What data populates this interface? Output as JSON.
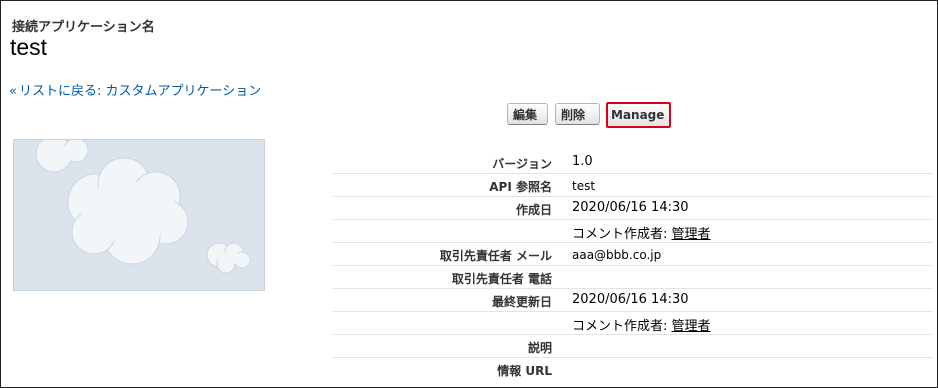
{
  "header": {
    "section_label": "接続アプリケーション名",
    "title": "test",
    "back_link": "リストに戻る: カスタムアプリケーション",
    "back_icon": "double-chevron-left-icon"
  },
  "buttons": {
    "edit": "編集",
    "delete": "削除",
    "manage": "Manage"
  },
  "logo": {
    "icon": "cloud-placeholder-image"
  },
  "details": {
    "version_label": "バージョン",
    "version_value": "1.0",
    "api_label": "API 参照名",
    "api_value": "test",
    "created_label": "作成日",
    "created_value": "2020/06/16 14:30",
    "created_by_prefix": "コメント作成者: ",
    "created_by_user": "管理者",
    "contact_email_label": "取引先責任者 メール",
    "contact_email_value": "aaa@bbb.co.jp",
    "contact_phone_label": "取引先責任者 電話",
    "modified_label": "最終更新日",
    "modified_value": "2020/06/16 14:30",
    "modified_by_prefix": "コメント作成者: ",
    "modified_by_user": "管理者",
    "description_label": "説明",
    "info_url_label": "情報 URL"
  }
}
